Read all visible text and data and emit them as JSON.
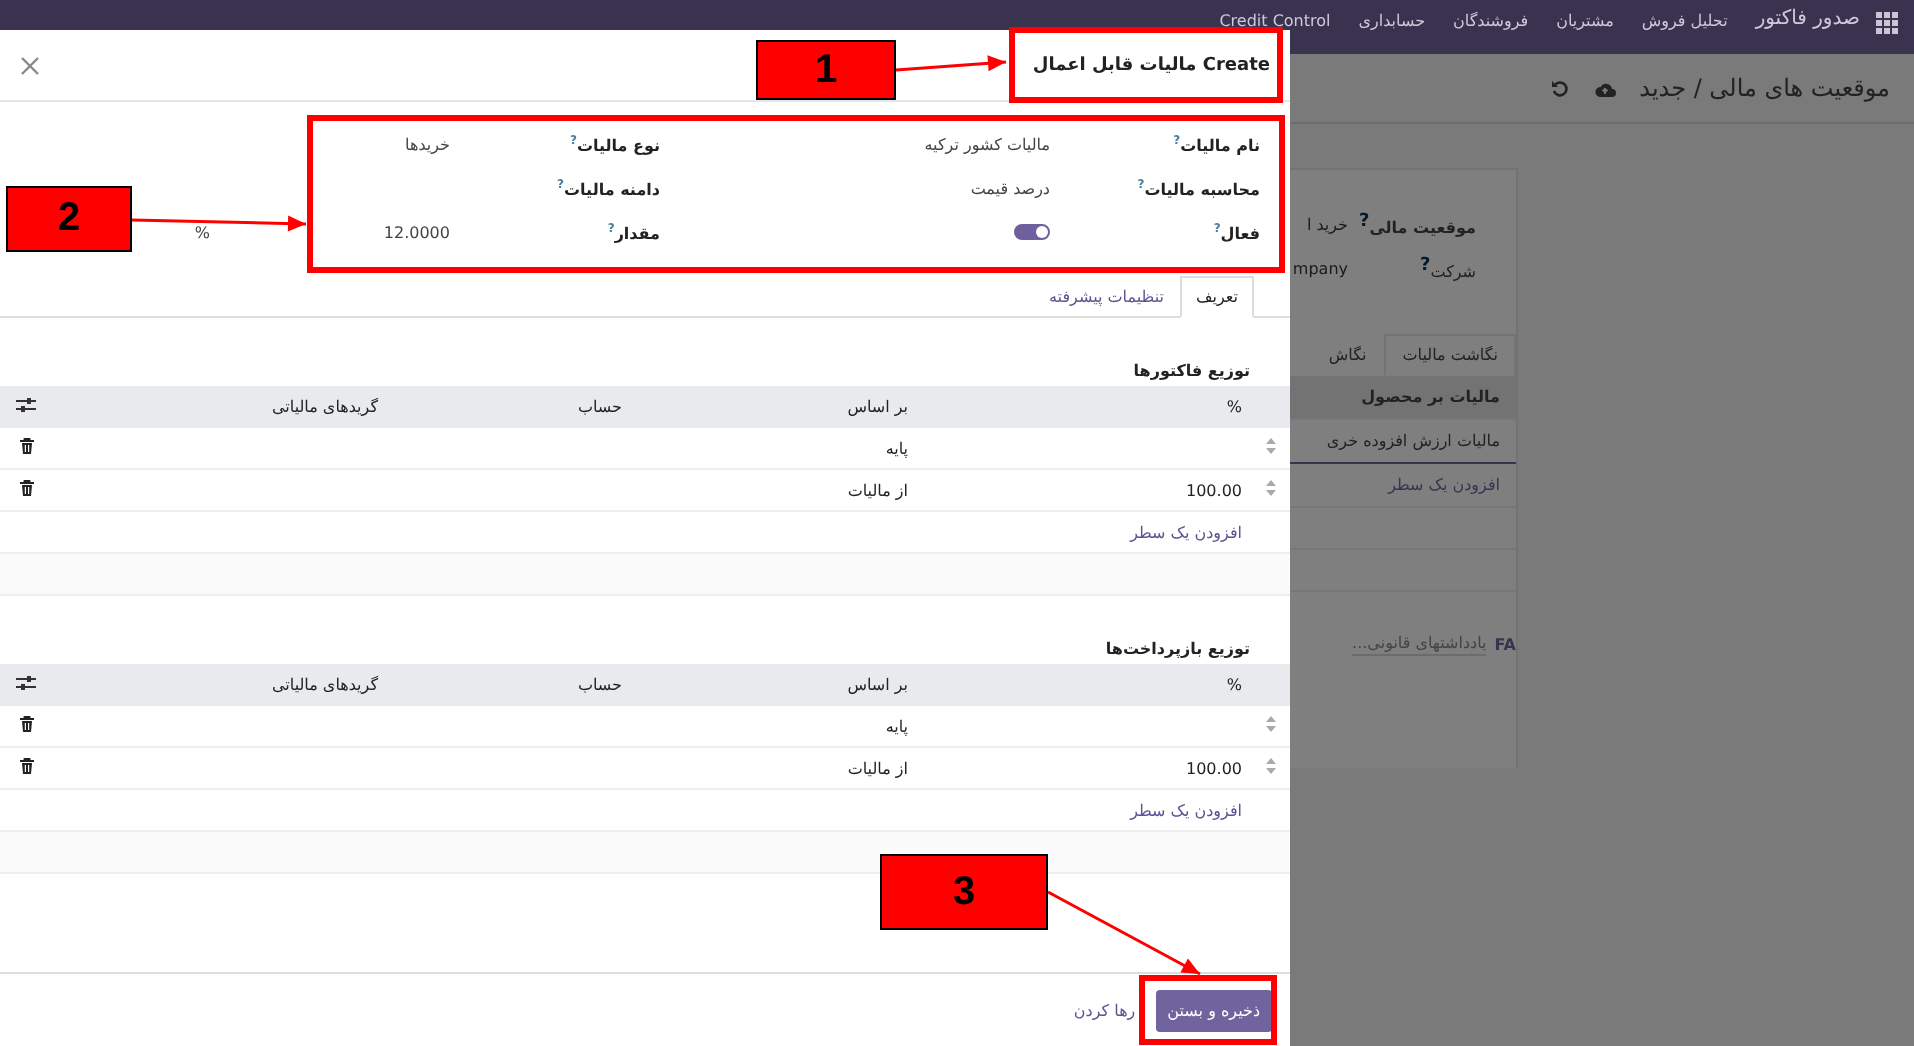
{
  "navbar": {
    "app_name": "صدور فاکتور",
    "menu": [
      "تحلیل فروش",
      "مشتریان",
      "فروشندگان",
      "حسابداری",
      "Credit Control"
    ]
  },
  "breadcrumb": "موقعیت های مالی / جدید",
  "background_form": {
    "fields": [
      {
        "label": "موقعیت مالی",
        "hint": "?",
        "value": "خرید ا",
        "bold": true
      },
      {
        "label": "شرکت",
        "hint": "?",
        "value": "mpany",
        "bold": false
      }
    ],
    "tabs": [
      {
        "label": "نگاشت مالیات",
        "selected": true
      },
      {
        "label": "نگاش",
        "selected": false
      }
    ],
    "rows": [
      {
        "text": "مالیات بر محصول",
        "kind": "header"
      },
      {
        "text": "مالیات ارزش افزوده خری",
        "kind": "row"
      },
      {
        "text": "افزودن یک سطر",
        "kind": "add"
      }
    ],
    "note": {
      "code": "FA",
      "placeholder": "یادداشتهای قانونی..."
    }
  },
  "modal": {
    "title": "Create مالیات قابل اعمال",
    "fields_right": [
      {
        "label": "نام مالیات",
        "hint": "?",
        "kind": "text",
        "value": "مالیات کشور ترکیه"
      },
      {
        "label": "محاسبه مالیات",
        "hint": "?",
        "kind": "text",
        "value": "درصد قیمت"
      },
      {
        "label": "فعال",
        "hint": "?",
        "kind": "toggle",
        "on": true
      }
    ],
    "fields_left": [
      {
        "label": "نوع مالیات",
        "hint": "?",
        "kind": "text",
        "value": "خریدها"
      },
      {
        "label": "دامنه مالیات",
        "hint": "?",
        "kind": "text"
      },
      {
        "label": "مقدار",
        "hint": "?",
        "kind": "amount",
        "value": "12.0000",
        "unit": "%"
      }
    ],
    "tabs": [
      {
        "label": "تعریف",
        "selected": true
      },
      {
        "label": "تنظیمات پیشرفته",
        "selected": false
      }
    ],
    "sections": [
      {
        "title": "توزیع فاکتورها",
        "columns": [
          "%",
          "بر اساس",
          "حساب",
          "گریدهای مالیاتی"
        ],
        "rows": [
          {
            "basis": "پایه"
          },
          {
            "percent": "100.00",
            "basis": "از مالیات"
          }
        ],
        "add_line": "افزودن یک سطر"
      },
      {
        "title": "توزیع بازپرداخت‌ها",
        "columns": [
          "%",
          "بر اساس",
          "حساب",
          "گریدهای مالیاتی"
        ],
        "rows": [
          {
            "basis": "پایه"
          },
          {
            "percent": "100.00",
            "basis": "از مالیات"
          }
        ],
        "add_line": "افزودن یک سطر"
      }
    ],
    "buttons": [
      {
        "label": "ذخیره و بستن",
        "kind": "primary"
      },
      {
        "label": "رها کردن",
        "kind": "link"
      }
    ]
  },
  "annotations": [
    {
      "label": "1"
    },
    {
      "label": "2"
    },
    {
      "label": "3"
    }
  ]
}
